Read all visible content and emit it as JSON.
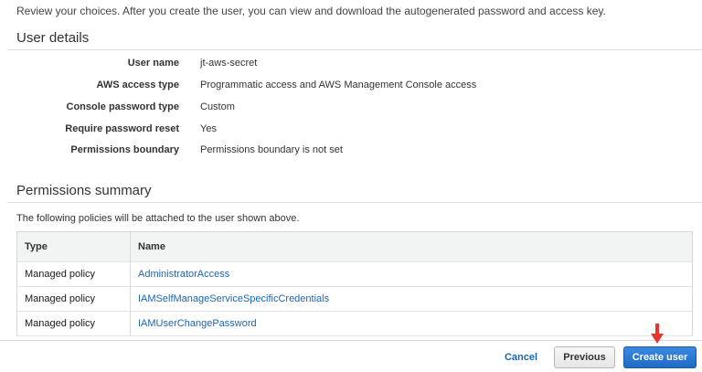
{
  "intro_text": "Review your choices. After you create the user, you can view and download the autogenerated password and access key.",
  "user_details": {
    "title": "User details",
    "rows": [
      {
        "label": "User name",
        "value": "jt-aws-secret"
      },
      {
        "label": "AWS access type",
        "value": "Programmatic access and AWS Management Console access"
      },
      {
        "label": "Console password type",
        "value": "Custom"
      },
      {
        "label": "Require password reset",
        "value": "Yes"
      },
      {
        "label": "Permissions boundary",
        "value": "Permissions boundary is not set"
      }
    ]
  },
  "permissions_summary": {
    "title": "Permissions summary",
    "description": "The following policies will be attached to the user shown above.",
    "columns": [
      "Type",
      "Name"
    ],
    "rows": [
      {
        "type": "Managed policy",
        "name": "AdministratorAccess"
      },
      {
        "type": "Managed policy",
        "name": "IAMSelfManageServiceSpecificCredentials"
      },
      {
        "type": "Managed policy",
        "name": "IAMUserChangePassword"
      }
    ]
  },
  "footer": {
    "cancel_label": "Cancel",
    "previous_label": "Previous",
    "create_label": "Create user"
  },
  "colors": {
    "link": "#1a66b8",
    "primary_button": "#2b7bd6",
    "annotation_arrow": "#e8362e"
  },
  "icons": {
    "annotation": "down-arrow-icon"
  }
}
